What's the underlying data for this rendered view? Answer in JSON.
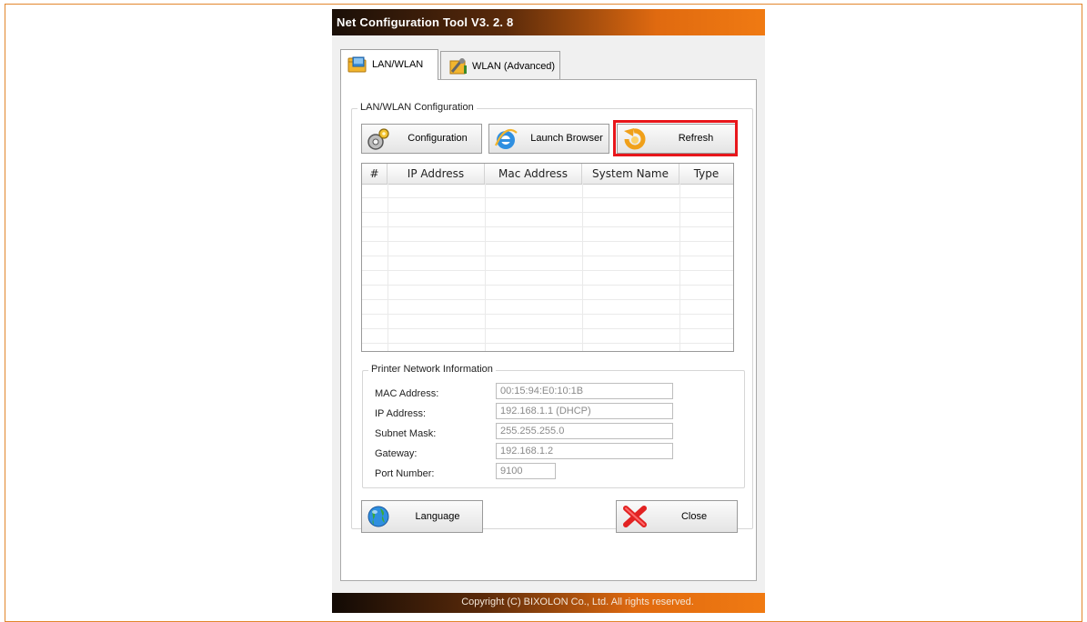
{
  "window": {
    "title": "Net Configuration Tool V3. 2. 8"
  },
  "tabs": [
    {
      "label": "LAN/WLAN",
      "icon": "network-folder-icon",
      "active": true
    },
    {
      "label": "WLAN (Advanced)",
      "icon": "wireless-tools-icon",
      "active": false
    }
  ],
  "config_group": {
    "legend": "LAN/WLAN Configuration",
    "buttons": {
      "configuration": "Configuration",
      "launch_browser": "Launch Browser",
      "refresh": "Refresh"
    }
  },
  "device_table": {
    "columns": [
      "#",
      "IP Address",
      "Mac Address",
      "System Name",
      "Type"
    ],
    "rows": []
  },
  "network_info": {
    "legend": "Printer Network Information",
    "mac_label": "MAC Address:",
    "mac_value": "00:15:94:E0:10:1B",
    "ip_label": "IP Address:",
    "ip_value": "192.168.1.1 (DHCP)",
    "subnet_label": "Subnet Mask:",
    "subnet_value": "255.255.255.0",
    "gateway_label": "Gateway:",
    "gateway_value": "192.168.1.2",
    "port_label": "Port Number:",
    "port_value": "9100"
  },
  "bottom_buttons": {
    "language": "Language",
    "close": "Close"
  },
  "footer": {
    "copyright": "Copyright (C) BIXOLON Co., Ltd. All rights reserved."
  },
  "colors": {
    "accent_orange": "#f07a12",
    "highlight_red": "#e8161b"
  }
}
